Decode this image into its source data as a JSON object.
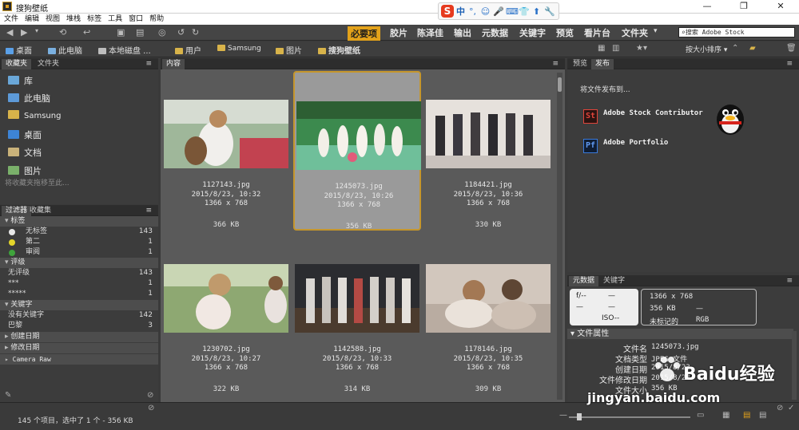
{
  "window": {
    "title": "搜狗壁纸"
  },
  "window_controls": [
    "—",
    "❐",
    "✕"
  ],
  "menu": [
    "文件",
    "编辑",
    "视图",
    "堆栈",
    "标签",
    "工具",
    "窗口",
    "帮助"
  ],
  "ime": {
    "logo": "S",
    "mode": "中",
    "icons": [
      "°,",
      "☺",
      "🎤",
      "⌨",
      "👕",
      "⬆",
      "🔧"
    ]
  },
  "workspaces": [
    "必要项",
    "胶片",
    "陈泽佳",
    "输出",
    "元数据",
    "关键字",
    "预览",
    "看片台",
    "文件夹"
  ],
  "search": {
    "placeholder": "搜索 Adobe Stock"
  },
  "sort": {
    "label": "按大小排序"
  },
  "breadcrumb": [
    "桌面",
    "此电脑",
    "本地磁盘 ...",
    "用户",
    "Samsung",
    "图片",
    "搜狗壁纸"
  ],
  "favorites_tabs": [
    "收藏夹",
    "文件夹"
  ],
  "favorites": {
    "items": [
      "库",
      "此电脑",
      "Samsung",
      "桌面",
      "文档",
      "图片"
    ],
    "hint": "将收藏夹拖移至此..."
  },
  "filter_tabs": [
    "过滤器",
    "收藏集"
  ],
  "filter": {
    "groups": [
      {
        "title": "标签",
        "rows": [
          {
            "label": "无标签",
            "count": "143",
            "color": "#e8e8e8"
          },
          {
            "label": "第二",
            "count": "1",
            "color": "#e3d52a"
          },
          {
            "label": "审阅",
            "count": "1",
            "color": "#3fa43c"
          }
        ]
      },
      {
        "title": "评级",
        "rows": [
          {
            "label": "无评级",
            "count": "143"
          },
          {
            "label": "***",
            "count": "1"
          },
          {
            "label": "*****",
            "count": "1"
          }
        ]
      },
      {
        "title": "关键字",
        "rows": [
          {
            "label": "没有关键字",
            "count": "142"
          },
          {
            "label": "巴黎",
            "count": "3"
          }
        ]
      },
      {
        "title": "创建日期",
        "rows": []
      },
      {
        "title": "修改日期",
        "rows": []
      },
      {
        "title": "Camera Raw",
        "rows": []
      }
    ]
  },
  "content_tab": "内容",
  "thumbnails": [
    {
      "name": "1127143.jpg",
      "date": "2015/8/23, 10:32",
      "dims": "1366 x 768",
      "size": "366 KB",
      "selected": false
    },
    {
      "name": "1245073.jpg",
      "date": "2015/8/23, 10:26",
      "dims": "1366 x 768",
      "size": "356 KB",
      "selected": true
    },
    {
      "name": "1184421.jpg",
      "date": "2015/8/23, 10:36",
      "dims": "1366 x 768",
      "size": "330 KB",
      "selected": false
    },
    {
      "name": "1230702.jpg",
      "date": "2015/8/23, 10:27",
      "dims": "1366 x 768",
      "size": "322 KB",
      "selected": false
    },
    {
      "name": "1142588.jpg",
      "date": "2015/8/23, 10:33",
      "dims": "1366 x 768",
      "size": "314 KB",
      "selected": false
    },
    {
      "name": "1178146.jpg",
      "date": "2015/8/23, 10:35",
      "dims": "1366 x 768",
      "size": "309 KB",
      "selected": false
    }
  ],
  "publish_tabs": [
    "预览",
    "发布"
  ],
  "publish": {
    "heading": "将文件发布到...",
    "items": [
      {
        "icon": "St",
        "label": "Adobe Stock Contributor",
        "color": "#e0443a"
      },
      {
        "icon": "Pf",
        "label": "Adobe Portfolio",
        "color": "#3b7bdc"
      }
    ]
  },
  "metadata_tabs": [
    "元数据",
    "关键字"
  ],
  "metadata": {
    "camera": {
      "f": "f/--",
      "a": "—",
      "b": "—",
      "c": "—",
      "iso": "ISO--"
    },
    "summary": {
      "dims": "1366 x 768",
      "size": "356 KB",
      "dash": "—",
      "state": "未标记的",
      "mode": "RGB"
    },
    "section": "文件属性",
    "props": [
      {
        "k": "文件名",
        "v": "1245073.jpg"
      },
      {
        "k": "文档类型",
        "v": "JPEG 文件"
      },
      {
        "k": "创建日期",
        "v": "2015/8/23"
      },
      {
        "k": "文件修改日期",
        "v": "2015/8/23"
      },
      {
        "k": "文件大小",
        "v": "356 KB"
      }
    ]
  },
  "status": {
    "text": "145 个项目，选中了 1 个 - 356 KB"
  },
  "watermark": {
    "brand": "Baidu经验",
    "url": "jingyan.baidu.com"
  }
}
